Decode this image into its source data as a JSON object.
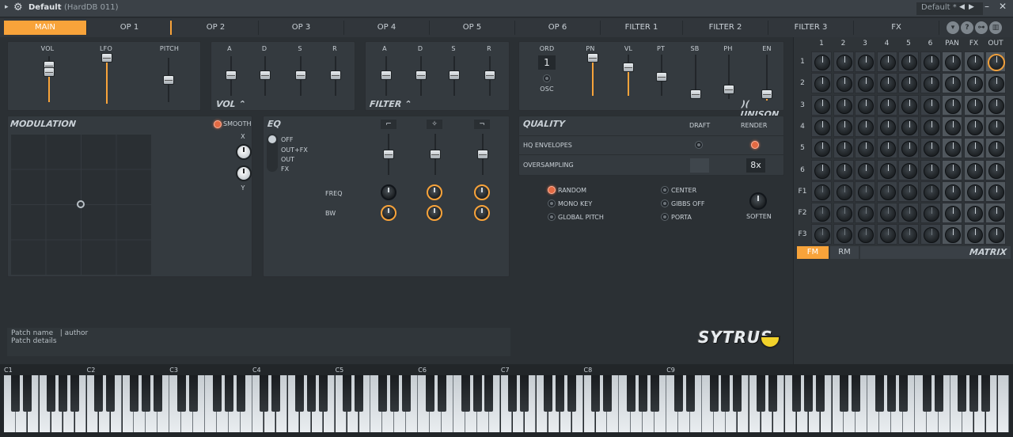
{
  "titlebar": {
    "title": "Default",
    "subtitle": "(HardDB 011)",
    "preset": "Default *"
  },
  "tabs": [
    "MAIN",
    "OP 1",
    "OP 2",
    "OP 3",
    "OP 4",
    "OP 5",
    "OP 6",
    "FILTER 1",
    "FILTER 2",
    "FILTER 3",
    "FX"
  ],
  "main": {
    "vol_label": "VOL",
    "lfo_label": "LFO",
    "pitch_label": "PITCH",
    "env_a": "A",
    "env_d": "D",
    "env_s": "S",
    "env_r": "R",
    "vol_section": "VOL",
    "filter_section": "FILTER",
    "ord": "ORD",
    "ord_value": "1",
    "osc": "OSC",
    "pn": "PN",
    "vl": "VL",
    "pt": "PT",
    "sb": "SB",
    "ph": "PH",
    "en": "EN",
    "unison": "UNISON",
    "modulation": "MODULATION",
    "smooth": "SMOOTH",
    "x": "X",
    "y": "Y",
    "eq": "EQ",
    "eq_off": "OFF",
    "eq_outfx": "OUT+FX",
    "eq_out": "OUT",
    "eq_fx": "FX",
    "freq": "FREQ",
    "bw": "BW",
    "quality": "QUALITY",
    "draft": "DRAFT",
    "render": "RENDER",
    "hq_env": "HQ ENVELOPES",
    "oversampling": "OVERSAMPLING",
    "oversampling_value": "8x",
    "random": "RANDOM",
    "mono_key": "MONO KEY",
    "global_pitch": "GLOBAL PITCH",
    "center": "CENTER",
    "gibbs_off": "GIBBS OFF",
    "porta": "PORTA",
    "soften": "SOFTEN",
    "patch_name": "Patch name",
    "author": "| author",
    "patch_details": "Patch details",
    "logo": "SYTRUS"
  },
  "matrix": {
    "cols": [
      "1",
      "2",
      "3",
      "4",
      "5",
      "6",
      "PAN",
      "FX",
      "OUT"
    ],
    "rows": [
      "1",
      "2",
      "3",
      "4",
      "5",
      "6",
      "F1",
      "F2",
      "F3"
    ],
    "fm": "FM",
    "rm": "RM",
    "title": "MATRIX"
  },
  "keyboard": {
    "octaves": [
      "C1",
      "C2",
      "C3",
      "C4",
      "C5",
      "C6",
      "C7",
      "C8",
      "C9"
    ]
  },
  "colors": {
    "accent": "#f8a33a",
    "panel": "#343a3f",
    "bg": "#2b3034"
  }
}
